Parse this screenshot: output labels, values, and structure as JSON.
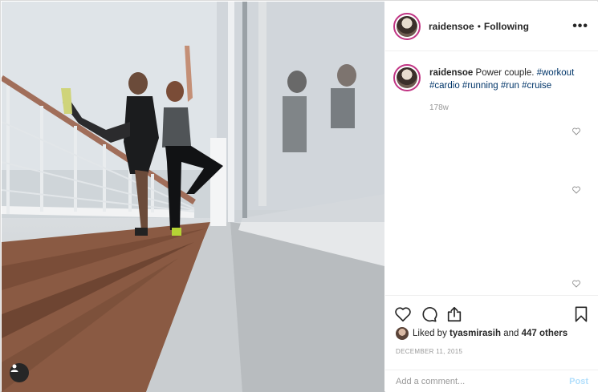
{
  "header": {
    "username": "raidensoe",
    "separator": "•",
    "follow_status": "Following",
    "more_icon": "more-horizontal-icon"
  },
  "caption": {
    "username": "raidensoe",
    "text": "Power couple.",
    "hashtags": [
      "#workout",
      "#cardio",
      "#running",
      "#run",
      "#cruise"
    ],
    "timestamp": "178w"
  },
  "actions": {
    "like_icon": "heart-icon",
    "comment_icon": "comment-icon",
    "share_icon": "share-icon",
    "save_icon": "bookmark-icon"
  },
  "likes": {
    "prefix": "Liked by",
    "user": "tyasmirasih",
    "middle": "and",
    "others": "447 others"
  },
  "date": "DECEMBER 11, 2015",
  "comment": {
    "placeholder": "Add a comment...",
    "post_label": "Post"
  },
  "colors": {
    "link": "#003569",
    "post_disabled": "#b2dffc",
    "avatar_ring": "#c13584"
  }
}
